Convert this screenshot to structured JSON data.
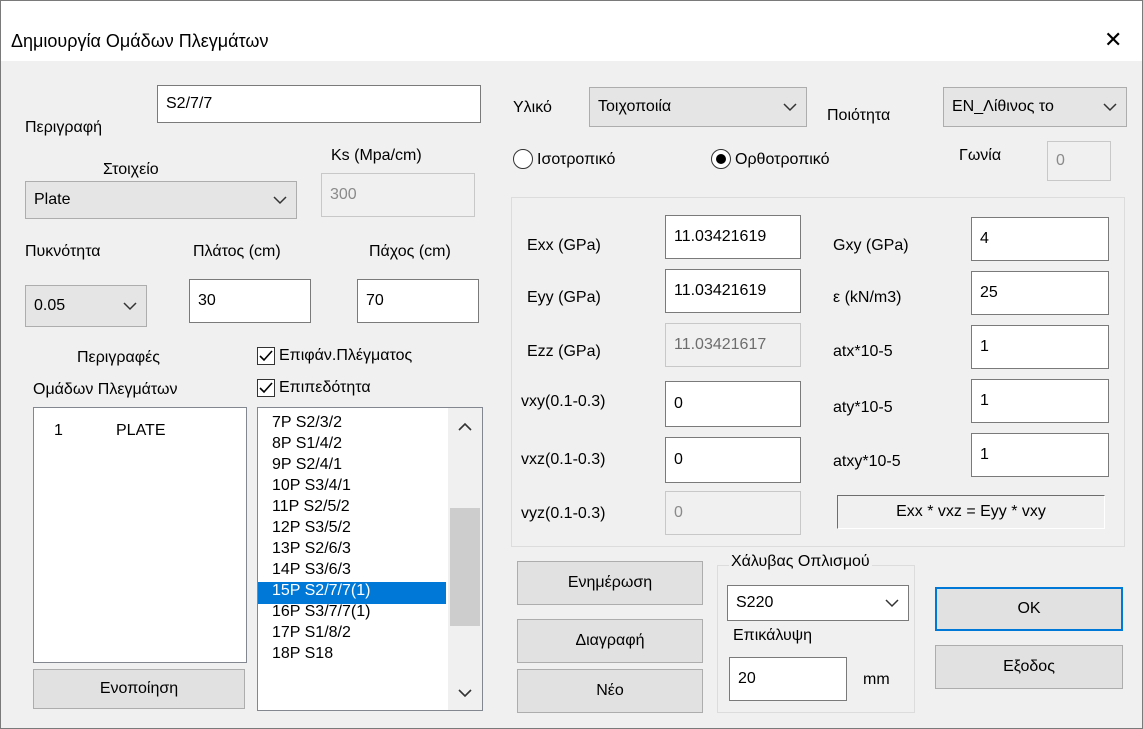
{
  "window": {
    "title": "Δημιουργία Ομάδων Πλεγμάτων",
    "close_glyph": "✕"
  },
  "left": {
    "description_label": "Περιγραφή",
    "description_value": "S2/7/7",
    "element_label": "Στοιχείο",
    "element_value": "Plate",
    "ks_label": "Ks (Mpa/cm)",
    "ks_value": "300",
    "density_label": "Πυκνότητα",
    "density_value": "0.05",
    "width_label": "Πλάτος (cm)",
    "width_value": "30",
    "thickness_label": "Πάχος (cm)",
    "thickness_value": "70",
    "groups_heading_line1": "Περιγραφές",
    "groups_heading_line2": "Ομάδων Πλεγμάτων",
    "groups": [
      {
        "index": "1",
        "name": "PLATE"
      }
    ],
    "surface_checkbox_label": "Επιφάν.Πλέγματος",
    "surface_checked": true,
    "plane_checkbox_label": "Επιπεδότητα",
    "plane_checked": true,
    "mesh_items": [
      "7P S2/3/2",
      "8P S1/4/2",
      "9P S2/4/1",
      "10P S3/4/1",
      "11P S2/5/2",
      "12P S3/5/2",
      "13P S2/6/3",
      "14P S3/6/3",
      "15P S2/7/7(1)",
      "16P S3/7/7(1)",
      "17P S1/8/2",
      "18P S18"
    ],
    "mesh_selected_index": 8,
    "unify_button": "Ενοποίηση"
  },
  "material": {
    "material_label": "Υλικό",
    "material_value": "Τοιχοποιία",
    "quality_label": "Ποιότητα",
    "quality_value": "EN_Λίθινος το",
    "isotropic_label": "Ισοτροπικό",
    "orthotropic_label": "Ορθοτροπικό",
    "selected": "orthotropic",
    "angle_label": "Γωνία",
    "angle_value": "0"
  },
  "properties": {
    "exx_label": "Exx (GPa)",
    "exx_value": "11.03421619",
    "eyy_label": "Eyy (GPa)",
    "eyy_value": "11.03421619",
    "ezz_label": "Ezz (GPa)",
    "ezz_value": "11.03421617",
    "vxy_label": "vxy(0.1-0.3)",
    "vxy_value": "0",
    "vxz_label": "vxz(0.1-0.3)",
    "vxz_value": "0",
    "vyz_label": "vyz(0.1-0.3)",
    "vyz_value": "0",
    "gxy_label": "Gxy (GPa)",
    "gxy_value": "4",
    "eps_label": "ε (kN/m3)",
    "eps_value": "25",
    "atx_label": "atx*10-5",
    "atx_value": "1",
    "aty_label": "aty*10-5",
    "aty_value": "1",
    "atxy_label": "atxy*10-5",
    "atxy_value": "1",
    "formula": "Exx * vxz = Eyy * vxy"
  },
  "actions": {
    "update_button": "Ενημέρωση",
    "delete_button": "Διαγραφή",
    "new_button": "Νέο",
    "ok_button": "OK",
    "exit_button": "Εξοδος"
  },
  "steel": {
    "heading": "Χάλυβας Οπλισμού",
    "steel_value": "S220",
    "cover_label": "Επικάλυψη",
    "cover_value": "20",
    "cover_unit": "mm"
  }
}
